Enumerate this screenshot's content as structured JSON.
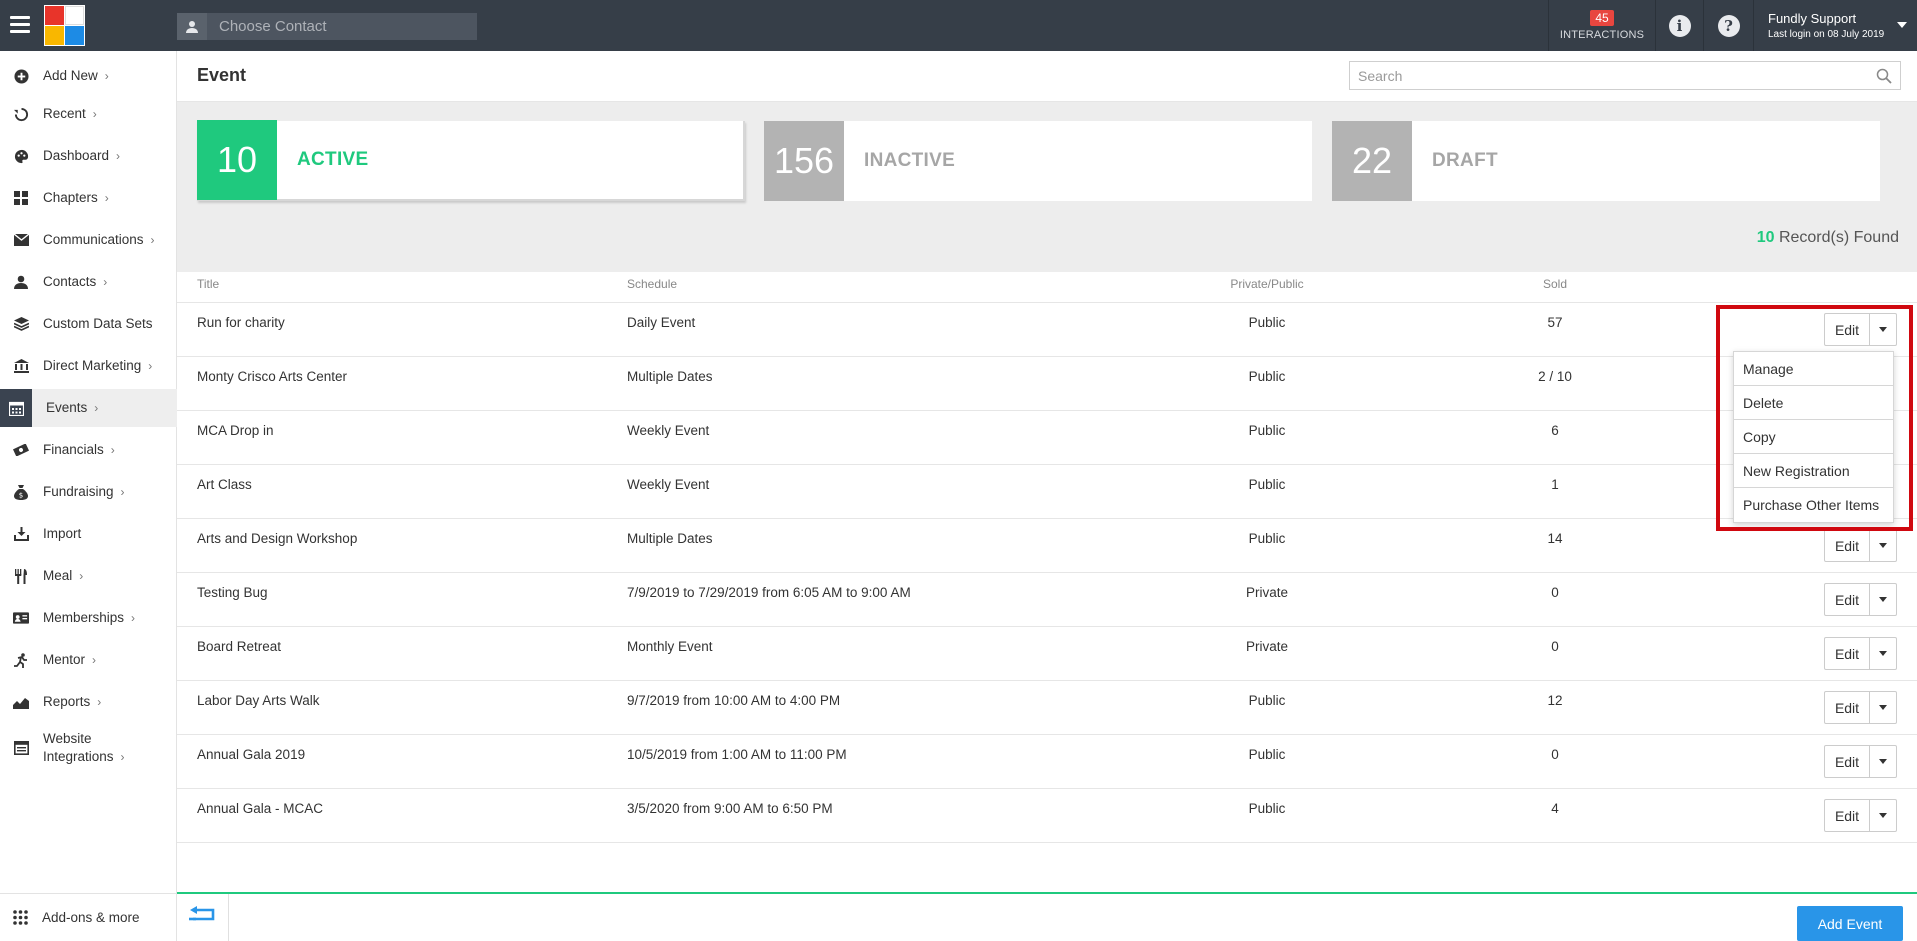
{
  "topbar": {
    "contact_placeholder": "Choose Contact",
    "interactions_count": "45",
    "interactions_label": "INTERACTIONS",
    "user_name": "Fundly Support",
    "last_login": "Last login on 08 July 2019"
  },
  "sidebar": {
    "items": [
      {
        "label": "Add New",
        "icon": "plus-circle-icon",
        "chevron": "›"
      },
      {
        "label": "Recent",
        "icon": "history-icon",
        "chevron": "›"
      },
      {
        "label": "Dashboard",
        "icon": "palette-icon",
        "chevron": "›"
      },
      {
        "label": "Chapters",
        "icon": "grid-icon",
        "chevron": "›"
      },
      {
        "label": "Communications",
        "icon": "envelope-icon",
        "chevron": "›"
      },
      {
        "label": "Contacts",
        "icon": "person-icon",
        "chevron": "›"
      },
      {
        "label": "Custom Data Sets",
        "icon": "layers-icon",
        "chevron": ""
      },
      {
        "label": "Direct Marketing",
        "icon": "bank-icon",
        "chevron": "›"
      },
      {
        "label": "Events",
        "icon": "calendar-icon",
        "chevron": "›"
      },
      {
        "label": "Financials",
        "icon": "money-icon",
        "chevron": "›"
      },
      {
        "label": "Fundraising",
        "icon": "moneybag-icon",
        "chevron": "›"
      },
      {
        "label": "Import",
        "icon": "download-icon",
        "chevron": ""
      },
      {
        "label": "Meal",
        "icon": "cutlery-icon",
        "chevron": "›"
      },
      {
        "label": "Memberships",
        "icon": "id-card-icon",
        "chevron": "›"
      },
      {
        "label": "Mentor",
        "icon": "running-icon",
        "chevron": "›"
      },
      {
        "label": "Reports",
        "icon": "area-chart-icon",
        "chevron": "›"
      },
      {
        "label": "Website",
        "label2": "Integrations",
        "icon": "browser-icon",
        "chevron": "›"
      }
    ],
    "bottom_label": "Add-ons & more"
  },
  "page": {
    "title": "Event",
    "search_placeholder": "Search"
  },
  "status": {
    "active": {
      "count": "10",
      "label": "ACTIVE",
      "color": "#1fc97e"
    },
    "inactive": {
      "count": "156",
      "label": "INACTIVE",
      "color": "#b3b3b3"
    },
    "draft": {
      "count": "22",
      "label": "DRAFT",
      "color": "#b3b3b3"
    }
  },
  "records": {
    "count": "10",
    "suffix": "Record(s) Found"
  },
  "table": {
    "headers": {
      "title": "Title",
      "schedule": "Schedule",
      "privacy": "Private/Public",
      "sold": "Sold"
    },
    "rows": [
      {
        "title": "Run for charity",
        "schedule": "Daily Event",
        "privacy": "Public",
        "sold": "57"
      },
      {
        "title": "Monty Crisco Arts Center",
        "schedule": "Multiple Dates",
        "privacy": "Public",
        "sold": "2 / 10"
      },
      {
        "title": "MCA Drop in",
        "schedule": "Weekly Event",
        "privacy": "Public",
        "sold": "6"
      },
      {
        "title": "Art Class",
        "schedule": "Weekly Event",
        "privacy": "Public",
        "sold": "1"
      },
      {
        "title": "Arts and Design Workshop",
        "schedule": "Multiple Dates",
        "privacy": "Public",
        "sold": "14"
      },
      {
        "title": "Testing Bug",
        "schedule": "7/9/2019 to 7/29/2019 from 6:05 AM to 9:00 AM",
        "privacy": "Private",
        "sold": "0"
      },
      {
        "title": "Board Retreat",
        "schedule": "Monthly Event",
        "privacy": "Private",
        "sold": "0"
      },
      {
        "title": "Labor Day Arts Walk",
        "schedule": "9/7/2019 from 10:00 AM to 4:00 PM",
        "privacy": "Public",
        "sold": "12"
      },
      {
        "title": "Annual Gala 2019",
        "schedule": "10/5/2019 from 1:00 AM to 11:00 PM",
        "privacy": "Public",
        "sold": "0"
      },
      {
        "title": "Annual Gala - MCAC",
        "schedule": "3/5/2020 from 9:00 AM to 6:50 PM",
        "privacy": "Public",
        "sold": "4"
      }
    ],
    "edit_label": "Edit"
  },
  "dropdown": {
    "items": [
      "Manage",
      "Delete",
      "Copy",
      "New Registration",
      "Purchase Other Items"
    ]
  },
  "footer": {
    "add_event_label": "Add Event"
  }
}
